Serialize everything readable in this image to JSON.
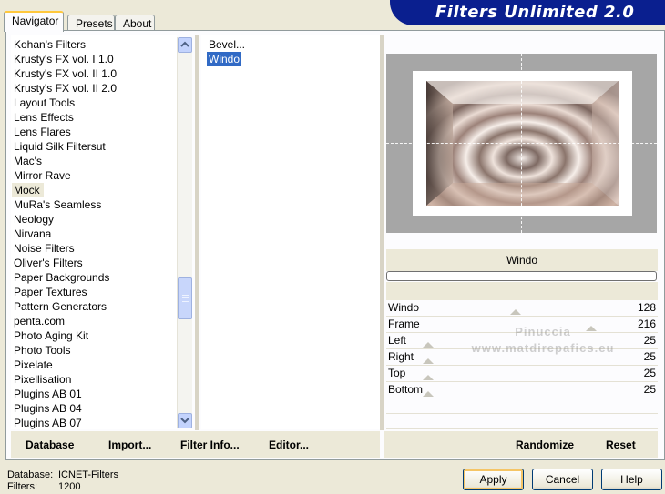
{
  "tabs": [
    "Navigator",
    "Presets",
    "About"
  ],
  "banner": {
    "title": "Filters Unlimited 2.0"
  },
  "categories": [
    "Kohan's Filters",
    "Krusty's FX vol. I 1.0",
    "Krusty's FX vol. II 1.0",
    "Krusty's FX vol. II 2.0",
    "Layout Tools",
    "Lens Effects",
    "Lens Flares",
    "Liquid Silk Filtersut",
    "Mac's",
    "Mirror Rave",
    "Mock",
    "MuRa's Seamless",
    "Neology",
    "Nirvana",
    "Noise Filters",
    "Oliver's Filters",
    "Paper Backgrounds",
    "Paper Textures",
    "Pattern Generators",
    "penta.com",
    "Photo Aging Kit",
    "Photo Tools",
    "Pixelate",
    "Pixellisation",
    "Plugins AB 01",
    "Plugins AB 04",
    "Plugins AB 07"
  ],
  "selected_category": "Mock",
  "filters": [
    "Bevel...",
    "Windo"
  ],
  "selected_filter": "Windo",
  "filter_title": "Windo",
  "params": [
    {
      "label": "Windo",
      "value": "128"
    },
    {
      "label": "Frame",
      "value": "216"
    },
    {
      "label": "Left",
      "value": "25"
    },
    {
      "label": "Right",
      "value": "25"
    },
    {
      "label": "Top",
      "value": "25"
    },
    {
      "label": "Bottom",
      "value": "25"
    }
  ],
  "watermark": {
    "line1": "Pinuccia",
    "line2": "www.matdirepafics.eu"
  },
  "commands_left": [
    "Database",
    "Import...",
    "Filter Info...",
    "Editor..."
  ],
  "commands_right": [
    "Randomize",
    "Reset"
  ],
  "status": {
    "database_label": "Database:",
    "database_value": "ICNET-Filters",
    "filters_label": "Filters:",
    "filters_value": "1200"
  },
  "buttons": {
    "apply": "Apply",
    "cancel": "Cancel",
    "help": "Help"
  },
  "icons": {
    "scroll_up": "chevron-up-icon",
    "scroll_down": "chevron-down-icon"
  },
  "colors": {
    "selection": "#316ac5",
    "banner": "#0a1f8f",
    "window_bg": "#ece9d8"
  }
}
